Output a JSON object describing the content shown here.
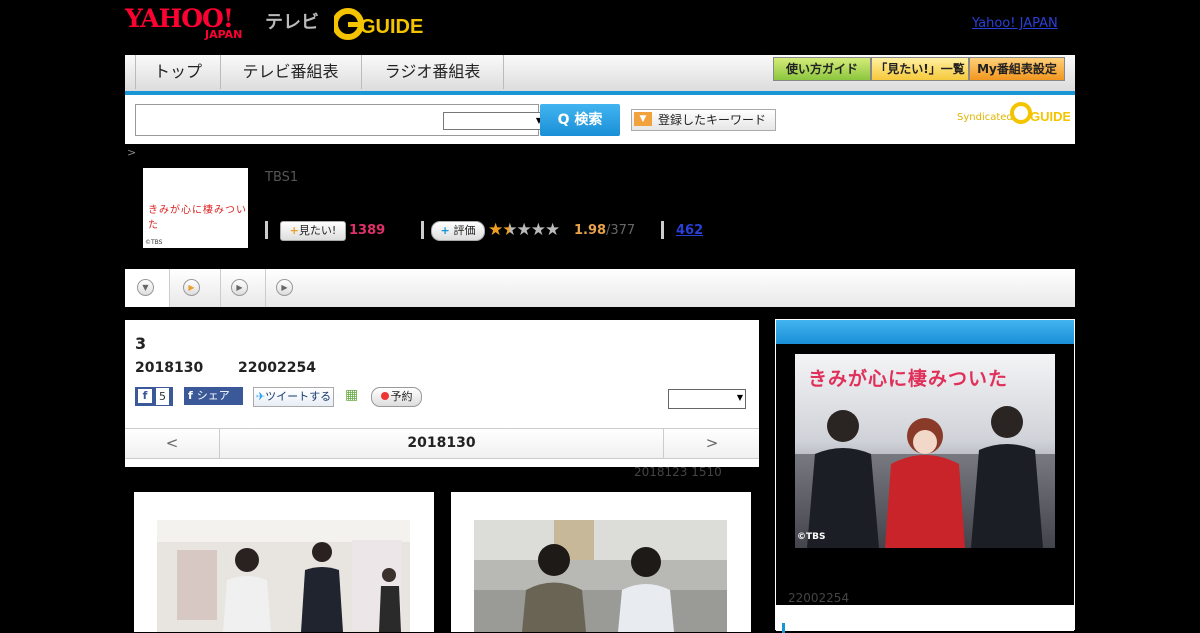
{
  "header": {
    "logo_yahoo": "YAHOO!",
    "logo_japan": "JAPAN",
    "logo_tv": "テレビ",
    "logo_gguide": "GUIDE",
    "yahoo_link": "Yahoo! JAPAN"
  },
  "nav": {
    "tabs": [
      {
        "label": "トップ"
      },
      {
        "label": "テレビ番組表"
      },
      {
        "label": "ラジオ番組表"
      }
    ],
    "guide_button": "使い方ガイド",
    "mitai_list_button": "「見たい!」一覧",
    "my_schedule_button": "My番組表設定"
  },
  "search": {
    "placeholder": "",
    "button_label": "Q 検索",
    "keyword_button": "登録したキーワード",
    "syndicated": "Syndicated"
  },
  "breadcrumb": ">",
  "program": {
    "thumb_title": "きみが心に棲みついた",
    "thumb_copy": "©TBS",
    "channel": "TBS1",
    "mitai_label": "見たい!",
    "mitai_count": "1389",
    "rate_label": "評価",
    "rating": "1.98",
    "rating_count": "/377",
    "review_count": "462"
  },
  "episode": {
    "number": "3",
    "date": "2018130",
    "time": "22002254",
    "fb_like_count": "5",
    "fb_share_label": "シェア",
    "tweet_label": "ツイートする",
    "reserve_label": "予約",
    "nav_prev": "<",
    "nav_date": "2018130",
    "nav_next": ">",
    "updated": "2018123  1510"
  },
  "side": {
    "poster_title": "きみが心に棲みついた",
    "poster_copy": "©TBS",
    "time": "22002254"
  },
  "colors": {
    "accent_blue": "#1a96d4",
    "mitai_pink": "#e0306a",
    "rating_orange": "#e8a24a",
    "link_blue": "#2a3fd6"
  },
  "icons": [
    "g-guide-logo",
    "search-icon",
    "keyword-arrow-icon",
    "plus-icon",
    "star-rating-icon",
    "play-circle-icon",
    "facebook-icon",
    "twitter-bird-icon",
    "calendar-icon",
    "record-dot-icon",
    "dropdown-arrow-icon"
  ]
}
